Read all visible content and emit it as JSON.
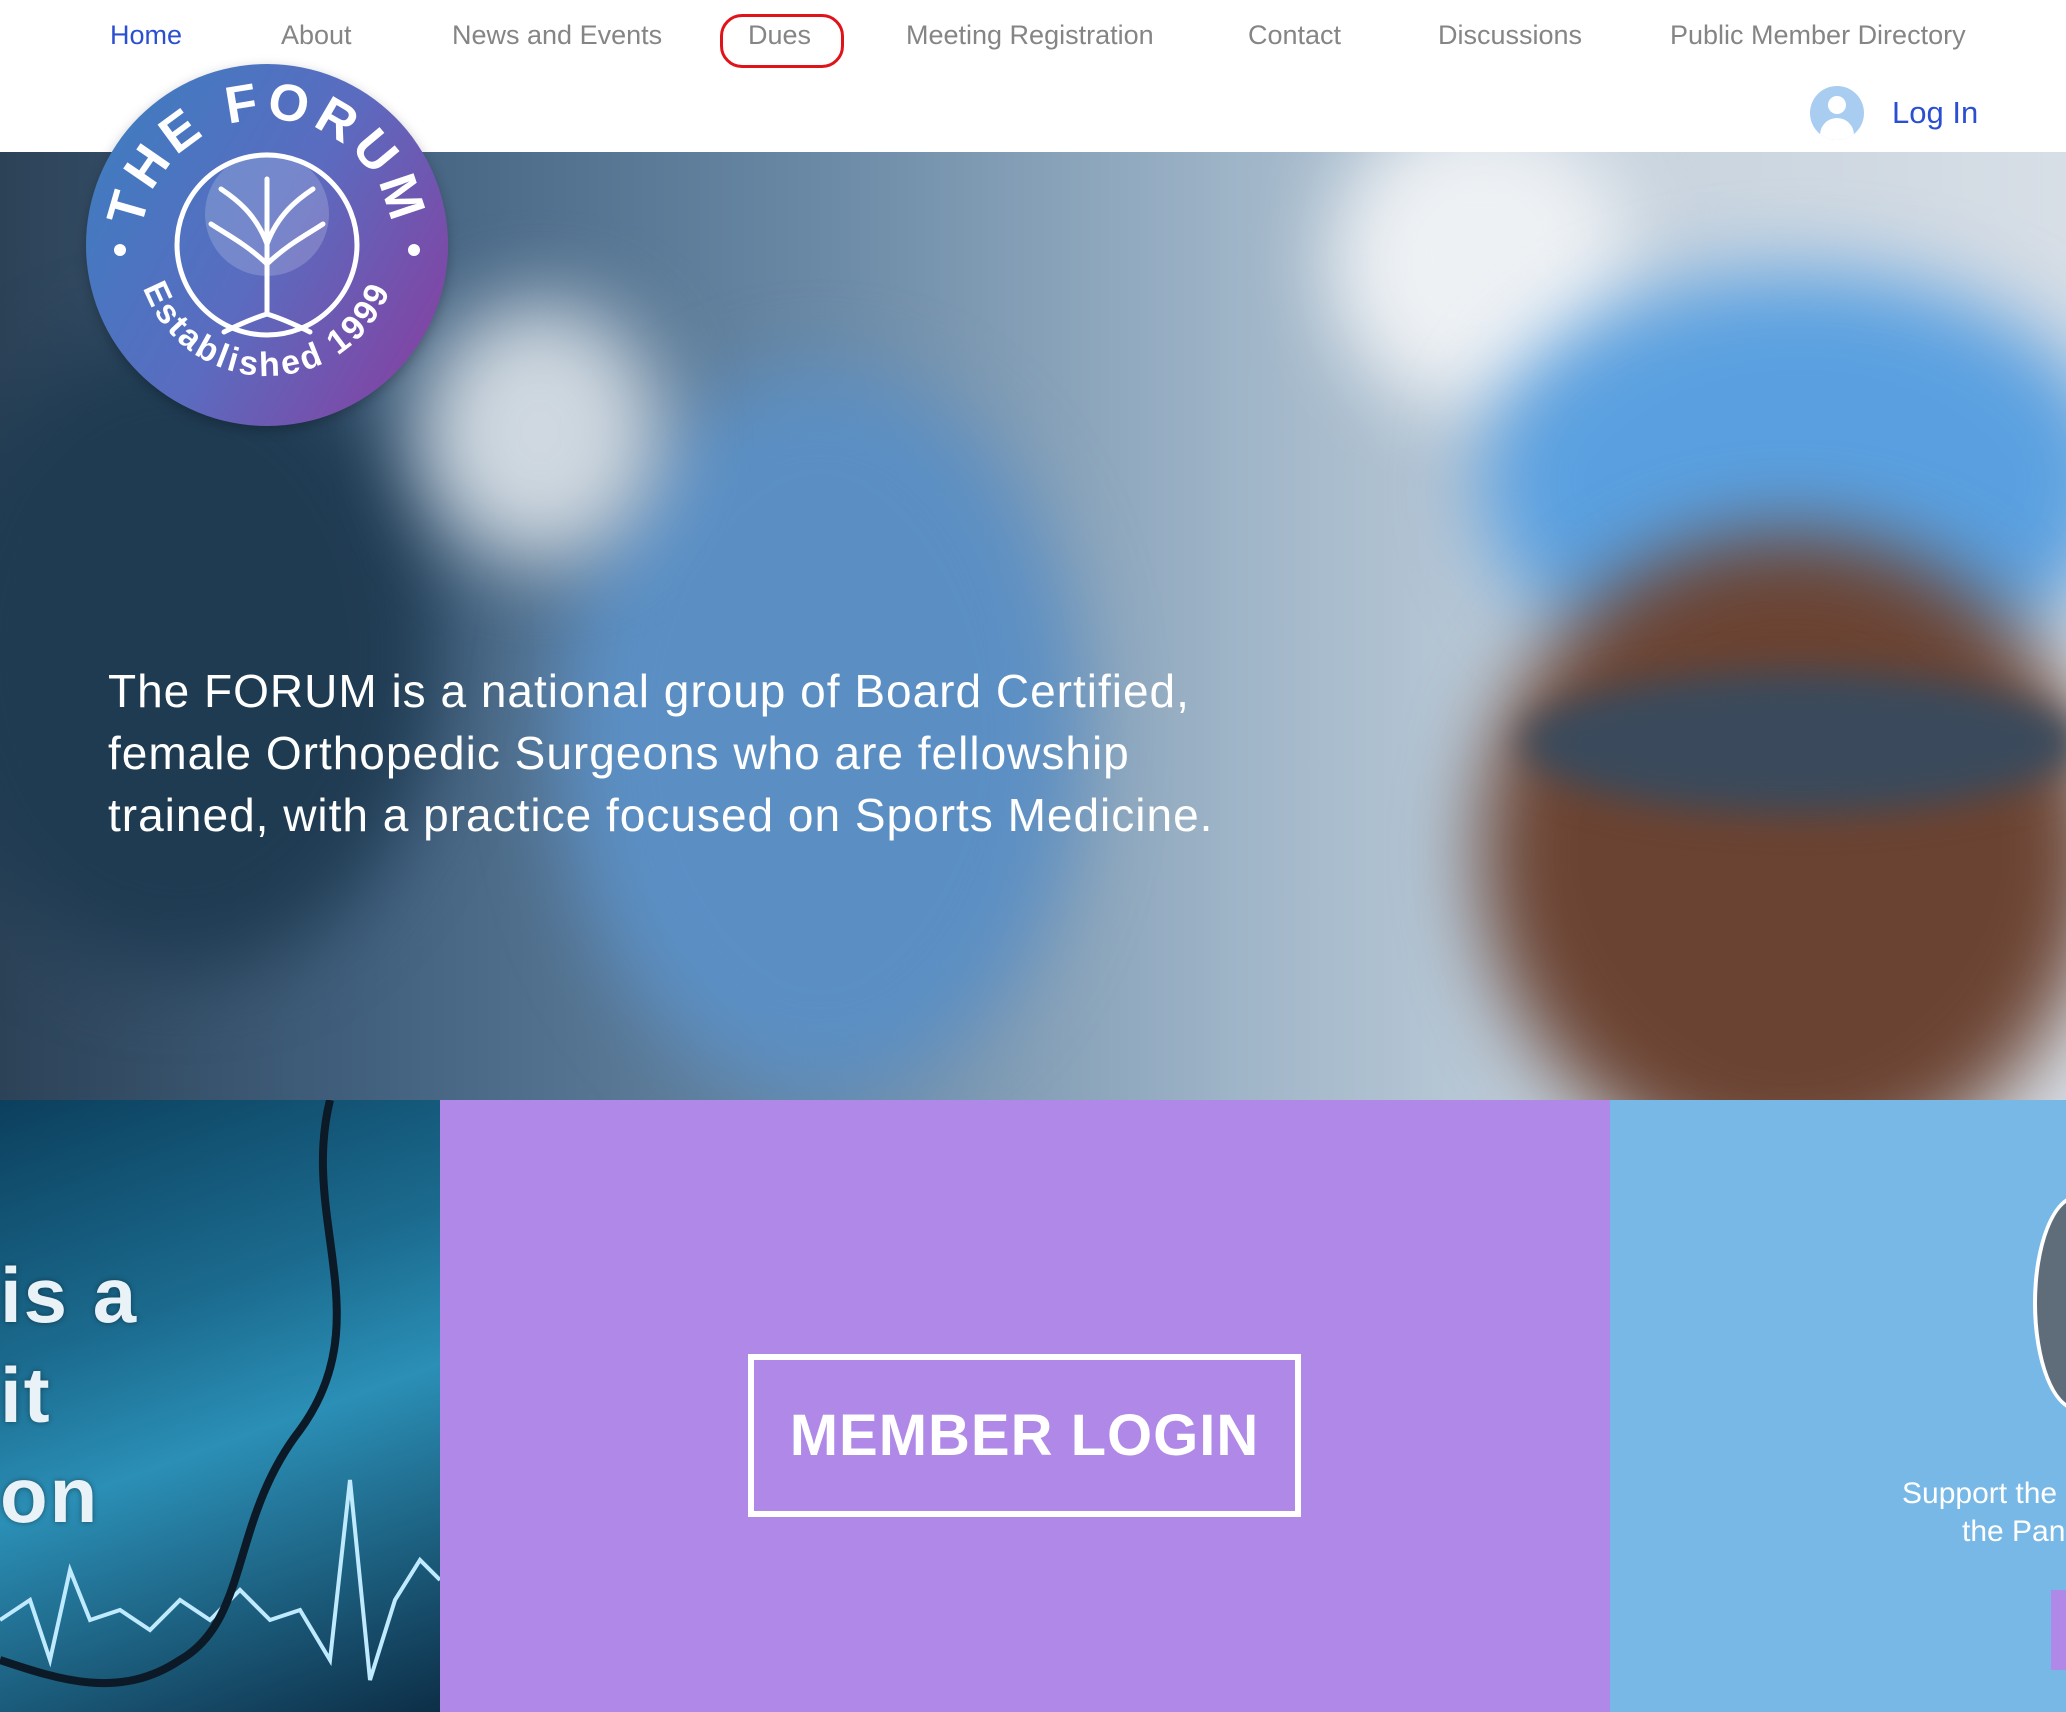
{
  "nav": {
    "items": [
      {
        "label": "Home",
        "active": true
      },
      {
        "label": "About"
      },
      {
        "label": "News and Events"
      },
      {
        "label": "Dues"
      },
      {
        "label": "Meeting Registration"
      },
      {
        "label": "Contact"
      },
      {
        "label": "Discussions"
      },
      {
        "label": "Public Member Directory"
      }
    ],
    "login_label": "Log In"
  },
  "logo": {
    "top_text": "THE FORUM",
    "bottom_text": "Established 1999"
  },
  "hero": {
    "text": "The FORUM is a national group of Board Certified, female Orthopedic Surgeons who are fellowship trained, with a practice focused on Sports Medicine."
  },
  "panels": {
    "left_fragments": [
      "is a",
      "it",
      "on"
    ],
    "member_login": "MEMBER LOGIN",
    "support_line1": "Support the",
    "support_line2": "the Pan"
  },
  "colors": {
    "accent": "#2b4fd1",
    "purple_panel": "#b088e7",
    "blue_panel": "#78b8e6",
    "highlight_ring": "#e0131a"
  }
}
